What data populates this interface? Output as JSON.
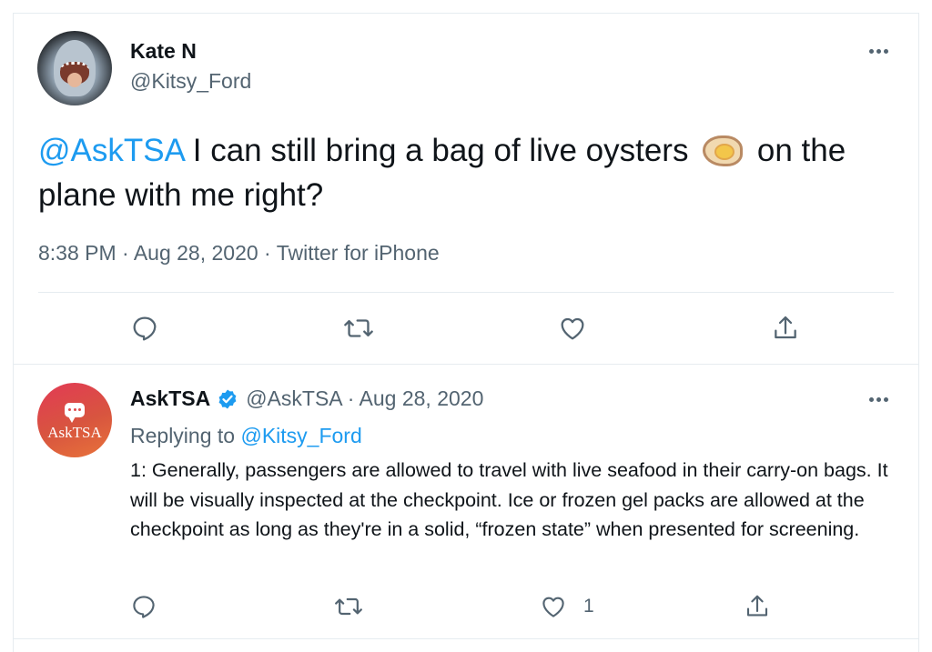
{
  "tweet": {
    "author_name": "Kate N",
    "author_handle": "@Kitsy_Ford",
    "mention": "@AskTSA",
    "text_part1": " I can still bring a bag of live oysters ",
    "emoji": "oyster-emoji",
    "text_part2": " on the plane with me right?",
    "meta": "8:38 PM · Aug 28, 2020 · Twitter for iPhone",
    "actions": [
      "reply-icon",
      "retweet-icon",
      "like-icon",
      "share-icon"
    ]
  },
  "reply": {
    "avatar_label": "AskTSA",
    "author_name": "AskTSA",
    "meta": "@AskTSA · Aug 28, 2020",
    "replying_prefix": "Replying to ",
    "replying_to": "@Kitsy_Ford",
    "text": "1: Generally, passengers are allowed to travel with live seafood in their carry-on bags. It will be visually inspected at the checkpoint. Ice or frozen gel packs are allowed at the checkpoint as long as they're in a solid, “frozen state” when presented for screening.",
    "like_count": "1",
    "actions": [
      "reply-icon",
      "retweet-icon",
      "like-icon",
      "share-icon"
    ]
  },
  "colors": {
    "link": "#1d9bf0",
    "secondary_text": "#536471",
    "primary_text": "#0f1419",
    "divider": "#e6ecf0"
  }
}
